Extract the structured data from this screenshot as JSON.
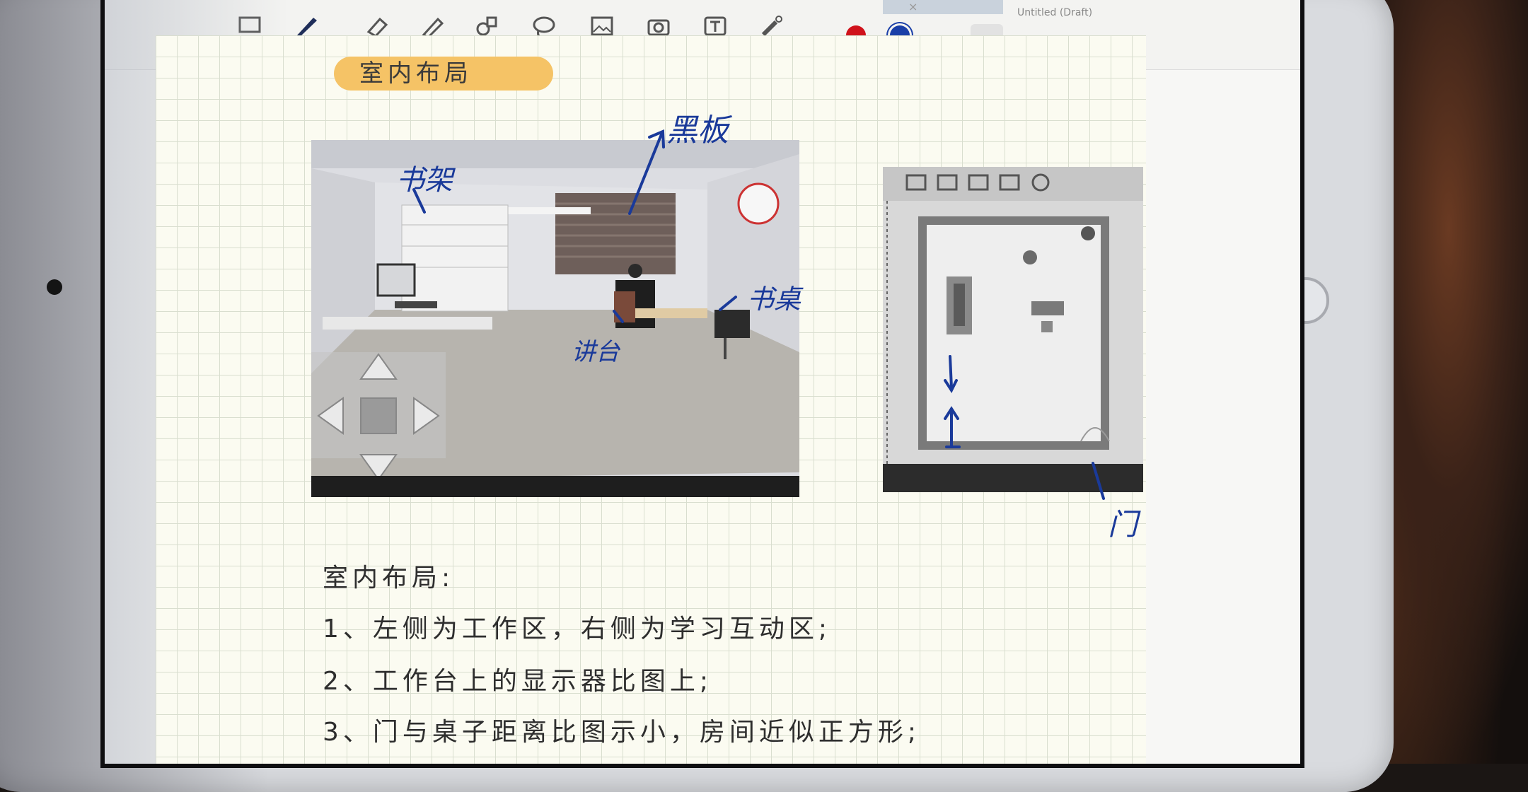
{
  "toolbar": {
    "tools": [
      {
        "name": "layout-icon"
      },
      {
        "name": "pen-icon"
      },
      {
        "name": "eraser-icon"
      },
      {
        "name": "highlighter-icon"
      },
      {
        "name": "shapes-icon"
      },
      {
        "name": "lasso-icon"
      },
      {
        "name": "image-icon"
      },
      {
        "name": "camera-icon"
      },
      {
        "name": "text-icon"
      },
      {
        "name": "laser-pointer-icon"
      }
    ],
    "doc_title": "Untitled (Draft)",
    "close_glyph": "×",
    "colors": [
      "#d0121b",
      "#1a3fa8"
    ],
    "stroke_widths": [
      "thin",
      "medium",
      "thick"
    ]
  },
  "section_title": "室内布局",
  "annotations": {
    "blackboard": "黑板",
    "bookshelf": "书架",
    "desk": "书桌",
    "podium": "讲台",
    "door": "门"
  },
  "notes": {
    "heading": "室内布局:",
    "items": [
      "1、左侧为工作区，右侧为学习互动区;",
      "2、工作台上的显示器比图上;",
      "3、门与桌子距离比图示小，房间近似正方形;"
    ]
  },
  "colors": {
    "paper": "#fbfbf1",
    "grid": "#d9decf",
    "title_highlight": "#f5c366",
    "ink": "#1a3a9a"
  }
}
